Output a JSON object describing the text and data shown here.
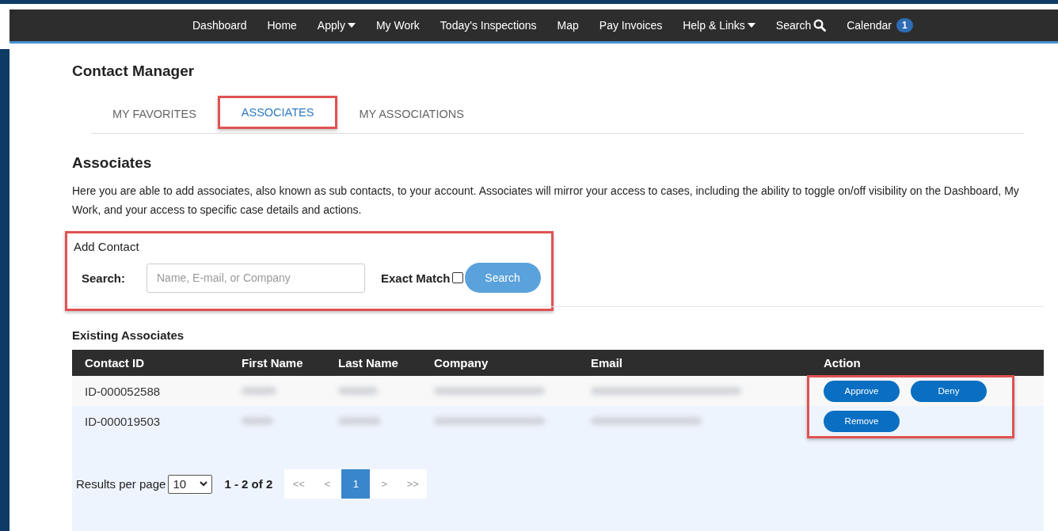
{
  "nav": [
    {
      "label": "Dashboard",
      "kind": "link"
    },
    {
      "label": "Home",
      "kind": "link"
    },
    {
      "label": "Apply",
      "kind": "dropdown"
    },
    {
      "label": "My Work",
      "kind": "link"
    },
    {
      "label": "Today's Inspections",
      "kind": "link"
    },
    {
      "label": "Map",
      "kind": "link"
    },
    {
      "label": "Pay Invoices",
      "kind": "link"
    },
    {
      "label": "Help & Links",
      "kind": "dropdown"
    },
    {
      "label": "Search",
      "kind": "search"
    },
    {
      "label": "Calendar",
      "kind": "badge",
      "badge": "1"
    }
  ],
  "page_title": "Contact Manager",
  "tabs": [
    {
      "label": "MY FAVORITES",
      "selected": false,
      "highlighted": false
    },
    {
      "label": "ASSOCIATES",
      "selected": true,
      "highlighted": true
    },
    {
      "label": "MY ASSOCIATIONS",
      "selected": false,
      "highlighted": false
    }
  ],
  "section_title": "Associates",
  "description": "Here you are able to add associates, also known as sub contacts, to your account. Associates will mirror your access to cases, including the ability to toggle on/off visibility on the Dashboard, My Work, and your access to specific case details and actions.",
  "add_contact": {
    "title": "Add Contact",
    "highlighted": true,
    "search_label": "Search:",
    "placeholder": "Name, E-mail, or Company",
    "exact_match_label": "Exact Match",
    "exact_match_checked": false,
    "button": "Search"
  },
  "existing_title": "Existing Associates",
  "table": {
    "columns": [
      "Contact ID",
      "First Name",
      "Last Name",
      "Company",
      "Email",
      "Action"
    ],
    "action_highlighted": true,
    "rows": [
      {
        "contact_id": "ID-000052588",
        "actions": [
          "Approve",
          "Deny"
        ]
      },
      {
        "contact_id": "ID-000019503",
        "actions": [
          "Remove"
        ]
      }
    ]
  },
  "pagination": {
    "label": "Results per page",
    "per_page": "10",
    "range": "1 - 2 of 2",
    "pages": [
      {
        "label": "<<",
        "selected": false
      },
      {
        "label": "<",
        "selected": false
      },
      {
        "label": "1",
        "selected": true
      },
      {
        "label": ">",
        "selected": false
      },
      {
        "label": ">>",
        "selected": false
      }
    ]
  }
}
